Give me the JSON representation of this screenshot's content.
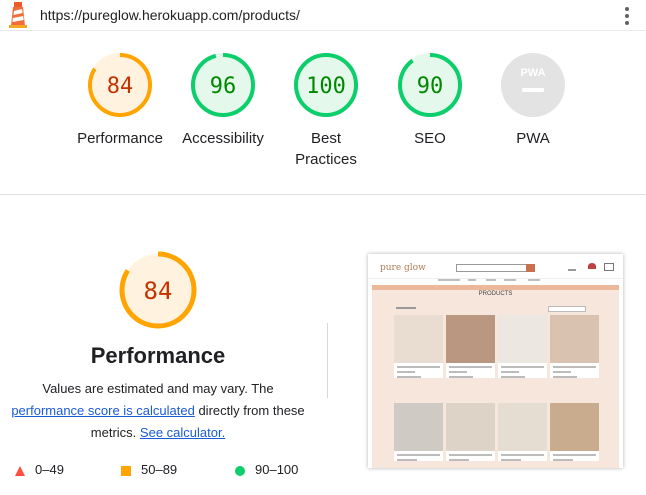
{
  "url": "https://pureglow.herokuapp.com/products/",
  "scores": [
    {
      "label": "Performance",
      "score": 84,
      "status": "average"
    },
    {
      "label": "Accessibility",
      "score": 96,
      "status": "pass"
    },
    {
      "label": "Best\nPractices",
      "score": 100,
      "status": "pass"
    },
    {
      "label": "SEO",
      "score": 90,
      "status": "pass"
    },
    {
      "label": "PWA",
      "score": null,
      "status": "na",
      "badge": "PWA"
    }
  ],
  "colors": {
    "pass_ring": "#0cce6b",
    "pass_text": "#008800",
    "pass_fill": "#e5f8ec",
    "avg_ring": "#ffa400",
    "avg_text": "#c33300",
    "avg_fill": "#fff3e0",
    "fail": "#ff4e42",
    "na": "#e3e3e3",
    "link": "#1a5bd6"
  },
  "detail": {
    "score": 84,
    "title": "Performance",
    "desc_prefix": "Values are estimated and may vary. The ",
    "desc_link1": "performance score is calculated",
    "desc_middle": " directly from these metrics. ",
    "desc_link2": "See calculator."
  },
  "legend": [
    {
      "icon": "triangle-icon",
      "range": "0–49",
      "color": "#ff4e42"
    },
    {
      "icon": "square-icon",
      "range": "50–89",
      "color": "#ffa400"
    },
    {
      "icon": "circle-icon",
      "range": "90–100",
      "color": "#0cce6b"
    }
  ],
  "screenshot": {
    "brand": "pure glow",
    "page_title": "PRODUCTS"
  }
}
